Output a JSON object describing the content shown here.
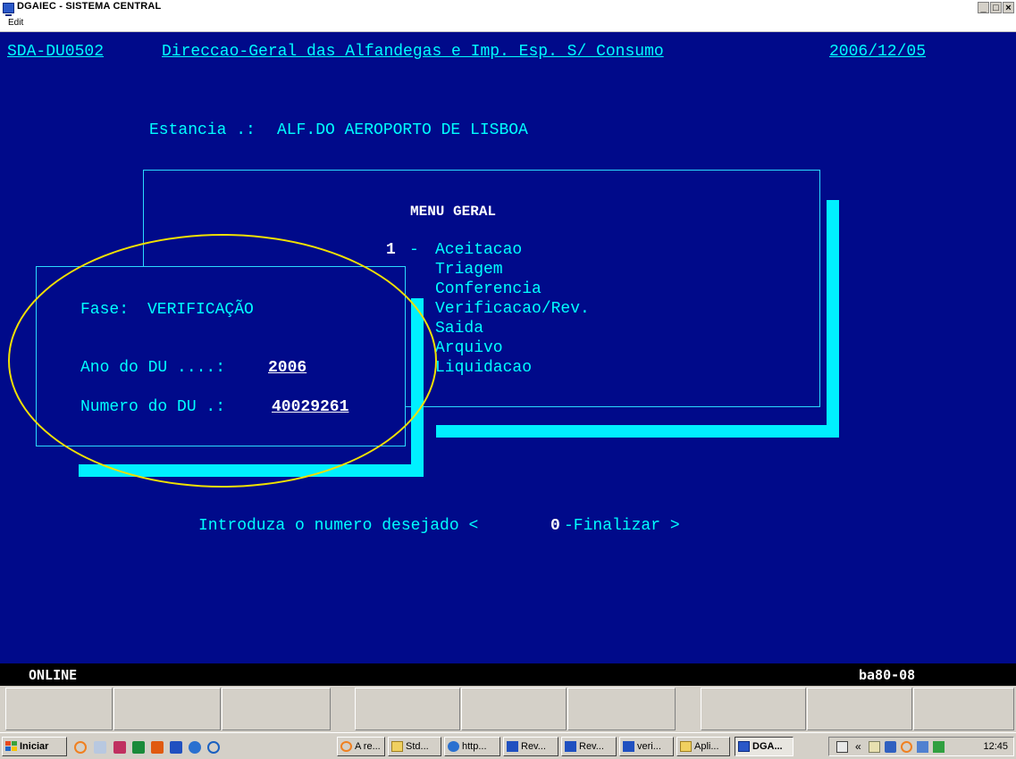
{
  "window": {
    "title": "DGAIEC - SISTEMA CENTRAL",
    "min_label": "_",
    "max_label": "□",
    "close_label": "×"
  },
  "menubar": {
    "edit_label": "Edit"
  },
  "terminal": {
    "program_id": "SDA-DU0502",
    "header_title": "Direccao-Geral das Alfandegas e Imp. Esp. S/ Consumo",
    "date": "2006/12/05",
    "estancia_label": "Estancia .:",
    "estancia_value": "ALF.DO AEROPORTO DE LISBOA",
    "menu": {
      "title": "MENU GERAL",
      "selected_number": "1",
      "dash": "-",
      "items": [
        "Aceitacao",
        "Triagem",
        "Conferencia",
        "Verificacao/Rev.",
        "Saida",
        "Arquivo",
        "Liquidacao"
      ]
    },
    "dialog": {
      "fase_label": "Fase:",
      "fase_value": "VERIFICAÇÃO",
      "ano_label": "Ano do DU ....:",
      "ano_value": "2006",
      "numero_label": "Numero do DU .:",
      "numero_value": "40029261"
    },
    "prompt_prefix": "Introduza o numero desejado <",
    "prompt_key": "0",
    "prompt_suffix": "-Finalizar >"
  },
  "statusline": {
    "left": "ONLINE",
    "right": "ba80-08"
  },
  "taskbar": {
    "start_label": "Iniciar",
    "tasks": [
      "A re...",
      "Std...",
      "http...",
      "Rev...",
      "Rev...",
      "veri...",
      "Apli...",
      "DGA..."
    ],
    "tray_chevron": "«",
    "clock": "12:45"
  },
  "colors": {
    "terminal_bg": "#000a8a",
    "terminal_text": "#00ffff",
    "highlight": "#ffffff",
    "shadow": "#00f0ff",
    "annotation_ellipse": "#f0e000"
  }
}
